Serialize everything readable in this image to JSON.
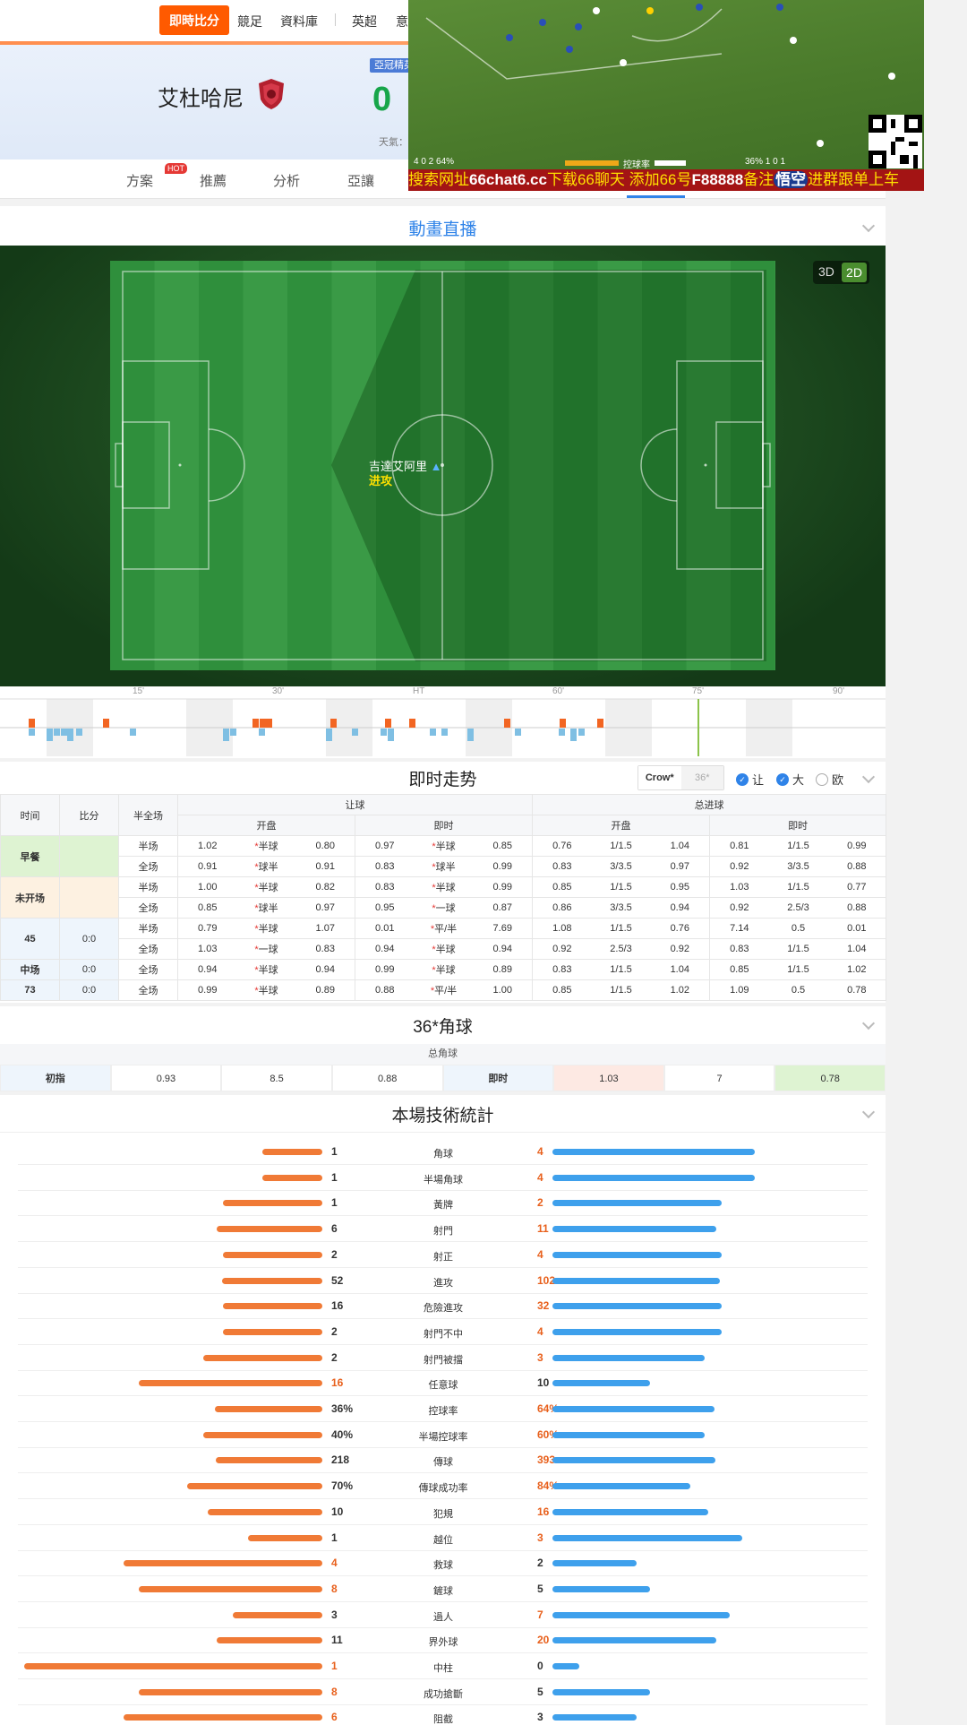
{
  "nav": {
    "live_score": "即時比分",
    "items": [
      "競足",
      "資料庫",
      "英超",
      "意"
    ]
  },
  "header": {
    "home_team": "艾杜哈尼",
    "league_badge": "亞冠精英",
    "home_score": "0",
    "weather_label": "天氣："
  },
  "subtabs": {
    "hot": "HOT",
    "items": [
      "方案",
      "推薦",
      "分析",
      "亞讓"
    ]
  },
  "video": {
    "banner_a": "搜索网址",
    "banner_url": "66chat6.cc",
    "banner_b": "下载66聊天 添加66号",
    "banner_id": "F88888",
    "banner_c": "备注",
    "banner_d": "悟空",
    "banner_e": "进群跟单上车",
    "stats_left": "4   0   2   64%",
    "stats_mid": "控球率",
    "stats_right": "36%   1   0   1"
  },
  "animation": {
    "title": "動畫直播",
    "mode_3d": "3D",
    "mode_2d": "2D",
    "player": "吉達艾阿里",
    "action": "进攻"
  },
  "timeline": {
    "ticks": [
      "15'",
      "30'",
      "HT",
      "60'",
      "75'",
      "90'"
    ]
  },
  "trend": {
    "title": "即时走势",
    "crow": "Crow*",
    "crow_alt": "36*",
    "opt_rang": "让",
    "opt_da": "大",
    "opt_ou": "欧",
    "head": {
      "time": "时间",
      "score": "比分",
      "half": "半全场",
      "rang": "让球",
      "total": "总进球",
      "kai": "开盘",
      "ji": "即时"
    },
    "rows": [
      {
        "time": "早餐",
        "score": "",
        "half": "半场",
        "a": [
          "1.02",
          "*半球",
          "0.80"
        ],
        "b": [
          "0.97",
          "*半球",
          "0.85"
        ],
        "c": [
          "0.76",
          "1/1.5",
          "1.04"
        ],
        "d": [
          "0.81",
          "1/1.5",
          "0.99"
        ]
      },
      {
        "time": "",
        "score": "",
        "half": "全场",
        "a": [
          "0.91",
          "*球半",
          "0.91"
        ],
        "b": [
          "0.83",
          "*球半",
          "0.99"
        ],
        "c": [
          "0.83",
          "3/3.5",
          "0.97"
        ],
        "d": [
          "0.92",
          "3/3.5",
          "0.88"
        ]
      },
      {
        "time": "未开场",
        "score": "",
        "half": "半场",
        "a": [
          "1.00",
          "*半球",
          "0.82"
        ],
        "b": [
          "0.83",
          "*半球",
          "0.99"
        ],
        "c": [
          "0.85",
          "1/1.5",
          "0.95"
        ],
        "d": [
          "1.03",
          "1/1.5",
          "0.77"
        ]
      },
      {
        "time": "",
        "score": "",
        "half": "全场",
        "a": [
          "0.85",
          "*球半",
          "0.97"
        ],
        "b": [
          "0.95",
          "*一球",
          "0.87"
        ],
        "c": [
          "0.86",
          "3/3.5",
          "0.94"
        ],
        "d": [
          "0.92",
          "2.5/3",
          "0.88"
        ]
      },
      {
        "time": "45",
        "score": "0:0",
        "half": "半场",
        "a": [
          "0.79",
          "*半球",
          "1.07"
        ],
        "b": [
          "0.01",
          "*平/半",
          "7.69"
        ],
        "c": [
          "1.08",
          "1/1.5",
          "0.76"
        ],
        "d": [
          "7.14",
          "0.5",
          "0.01"
        ]
      },
      {
        "time": "",
        "score": "",
        "half": "全场",
        "a": [
          "1.03",
          "*一球",
          "0.83"
        ],
        "b": [
          "0.94",
          "*半球",
          "0.94"
        ],
        "c": [
          "0.92",
          "2.5/3",
          "0.92"
        ],
        "d": [
          "0.83",
          "1/1.5",
          "1.04"
        ]
      },
      {
        "time": "中场",
        "score": "0:0",
        "half": "全场",
        "a": [
          "0.94",
          "*半球",
          "0.94"
        ],
        "b": [
          "0.99",
          "*半球",
          "0.89"
        ],
        "c": [
          "0.83",
          "1/1.5",
          "1.04"
        ],
        "d": [
          "0.85",
          "1/1.5",
          "1.02"
        ]
      },
      {
        "time": "73",
        "score": "0:0",
        "half": "全场",
        "a": [
          "0.99",
          "*半球",
          "0.89"
        ],
        "b": [
          "0.88",
          "*平/半",
          "1.00"
        ],
        "c": [
          "0.85",
          "1/1.5",
          "1.02"
        ],
        "d": [
          "1.09",
          "0.5",
          "0.78"
        ]
      }
    ]
  },
  "corner": {
    "title": "36*角球",
    "sub": "总角球",
    "cells": [
      "初指",
      "0.93",
      "8.5",
      "0.88",
      "即时",
      "1.03",
      "7",
      "0.78"
    ]
  },
  "stats": {
    "title": "本場技術統計",
    "rows": [
      {
        "name": "角球",
        "home": "1",
        "away": "4"
      },
      {
        "name": "半場角球",
        "home": "1",
        "away": "4"
      },
      {
        "name": "黃牌",
        "home": "1",
        "away": "2"
      },
      {
        "name": "射門",
        "home": "6",
        "away": "11"
      },
      {
        "name": "射正",
        "home": "2",
        "away": "4"
      },
      {
        "name": "進攻",
        "home": "52",
        "away": "102"
      },
      {
        "name": "危險進攻",
        "home": "16",
        "away": "32"
      },
      {
        "name": "射門不中",
        "home": "2",
        "away": "4"
      },
      {
        "name": "射門被擋",
        "home": "2",
        "away": "3"
      },
      {
        "name": "任意球",
        "home": "16",
        "away": "10"
      },
      {
        "name": "控球率",
        "home": "36%",
        "away": "64%"
      },
      {
        "name": "半場控球率",
        "home": "40%",
        "away": "60%"
      },
      {
        "name": "傳球",
        "home": "218",
        "away": "393"
      },
      {
        "name": "傳球成功率",
        "home": "70%",
        "away": "84%"
      },
      {
        "name": "犯規",
        "home": "10",
        "away": "16"
      },
      {
        "name": "越位",
        "home": "1",
        "away": "3"
      },
      {
        "name": "救球",
        "home": "4",
        "away": "2"
      },
      {
        "name": "鏟球",
        "home": "8",
        "away": "5"
      },
      {
        "name": "過人",
        "home": "3",
        "away": "7"
      },
      {
        "name": "界外球",
        "home": "11",
        "away": "20"
      },
      {
        "name": "中柱",
        "home": "1",
        "away": "0"
      },
      {
        "name": "成功搶斷",
        "home": "8",
        "away": "5"
      },
      {
        "name": "阻截",
        "home": "6",
        "away": "3"
      }
    ]
  },
  "colors": {
    "accent": "#ff5a00",
    "home_bar": "#f07a36",
    "away_bar": "#3ea0ec",
    "pitch": "#2f8f3c",
    "link_blue": "#2f83e8"
  }
}
